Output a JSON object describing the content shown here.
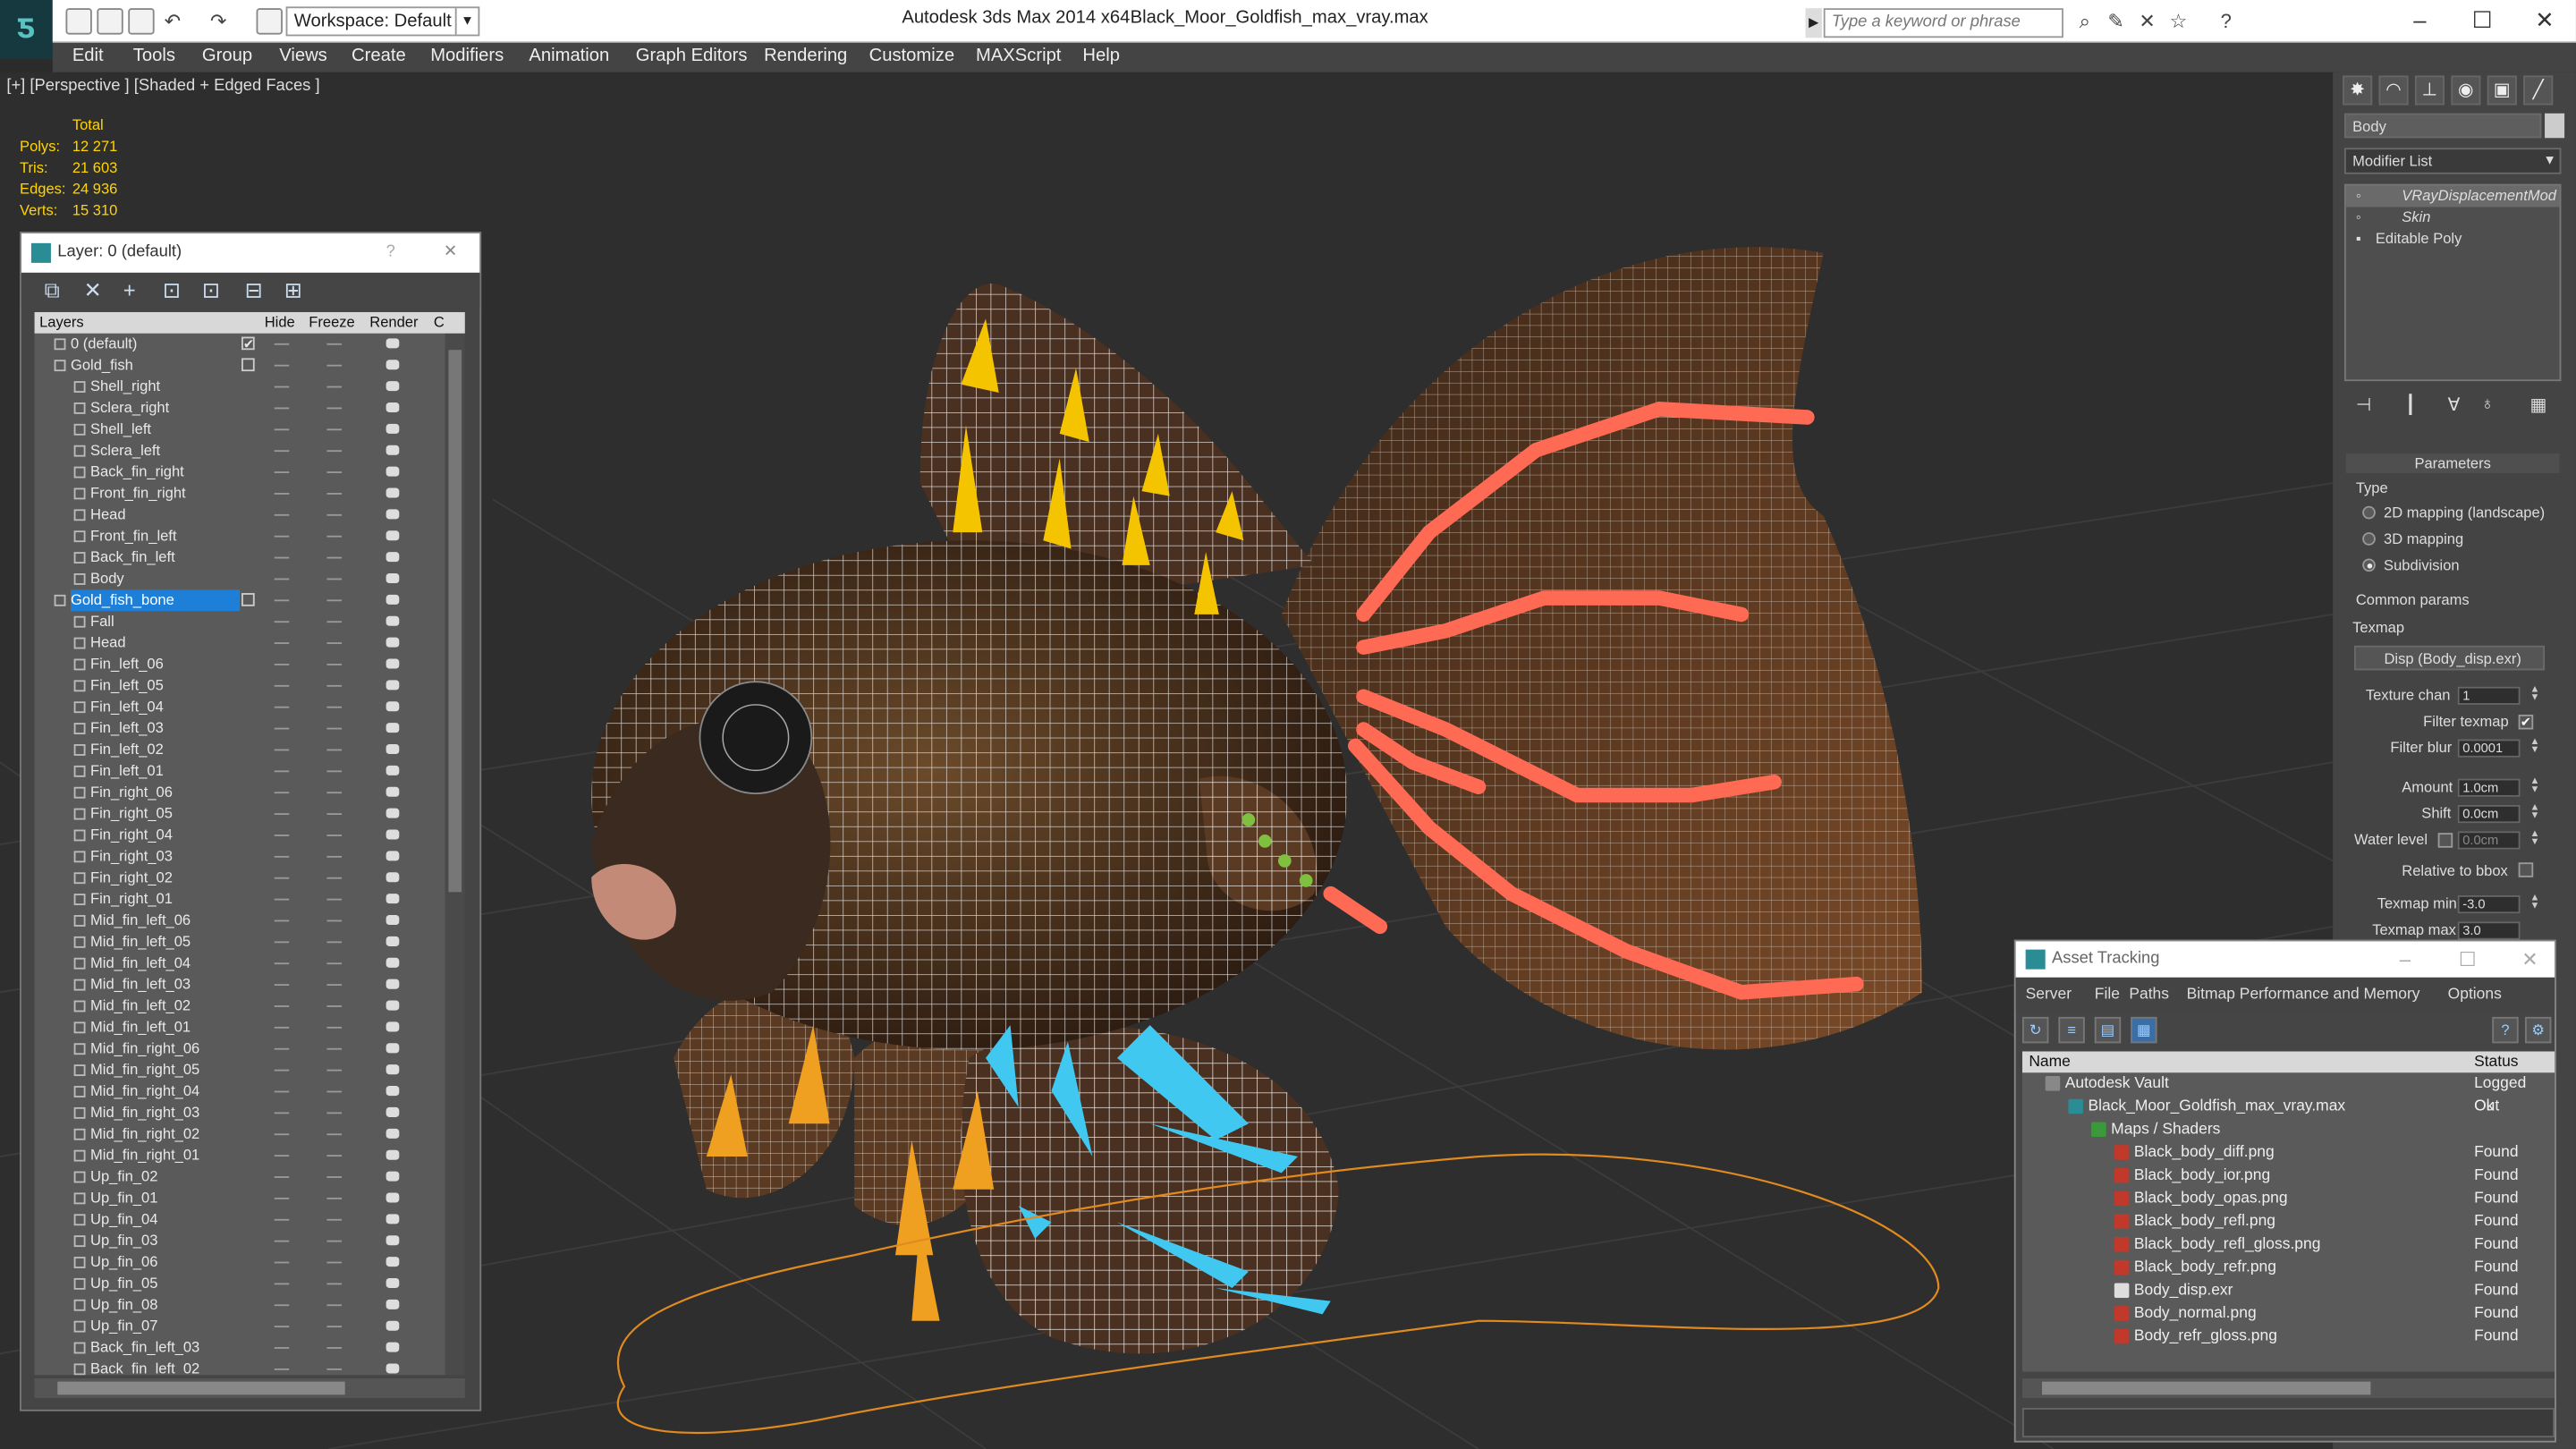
{
  "titlebar": {
    "workspace": "Workspace: Default",
    "app_title": "Autodesk 3ds Max 2014 x64",
    "file_title": "Black_Moor_Goldfish_max_vray.max",
    "search_placeholder": "Type a keyword or phrase"
  },
  "menu": [
    "Edit",
    "Tools",
    "Group",
    "Views",
    "Create",
    "Modifiers",
    "Animation",
    "Graph Editors",
    "Rendering",
    "Customize",
    "MAXScript",
    "Help"
  ],
  "viewport": {
    "label": "[+] [Perspective ] [Shaded + Edged Faces ]",
    "stats": {
      "header": "Total",
      "rows": [
        {
          "k": "Polys:",
          "v": "12 271"
        },
        {
          "k": "Tris:",
          "v": "21 603"
        },
        {
          "k": "Edges:",
          "v": "24 936"
        },
        {
          "k": "Verts:",
          "v": "15 310"
        }
      ]
    }
  },
  "layer_window": {
    "title": "Layer: 0 (default)",
    "help": "?",
    "close": "✕",
    "columns": [
      "Layers",
      "Hide",
      "Freeze",
      "Render",
      "C"
    ],
    "rows": [
      {
        "name": "0 (default)",
        "indent": 0,
        "check": "✔"
      },
      {
        "name": "Gold_fish",
        "indent": 0
      },
      {
        "name": "Shell_right",
        "indent": 1
      },
      {
        "name": "Sclera_right",
        "indent": 1
      },
      {
        "name": "Shell_left",
        "indent": 1
      },
      {
        "name": "Sclera_left",
        "indent": 1
      },
      {
        "name": "Back_fin_right",
        "indent": 1
      },
      {
        "name": "Front_fin_right",
        "indent": 1
      },
      {
        "name": "Head",
        "indent": 1
      },
      {
        "name": "Front_fin_left",
        "indent": 1
      },
      {
        "name": "Back_fin_left",
        "indent": 1
      },
      {
        "name": "Body",
        "indent": 1
      },
      {
        "name": "Gold_fish_bone",
        "indent": 0,
        "selected": true
      },
      {
        "name": "Fall",
        "indent": 1
      },
      {
        "name": "Head",
        "indent": 1
      },
      {
        "name": "Fin_left_06",
        "indent": 1
      },
      {
        "name": "Fin_left_05",
        "indent": 1
      },
      {
        "name": "Fin_left_04",
        "indent": 1
      },
      {
        "name": "Fin_left_03",
        "indent": 1
      },
      {
        "name": "Fin_left_02",
        "indent": 1
      },
      {
        "name": "Fin_left_01",
        "indent": 1
      },
      {
        "name": "Fin_right_06",
        "indent": 1
      },
      {
        "name": "Fin_right_05",
        "indent": 1
      },
      {
        "name": "Fin_right_04",
        "indent": 1
      },
      {
        "name": "Fin_right_03",
        "indent": 1
      },
      {
        "name": "Fin_right_02",
        "indent": 1
      },
      {
        "name": "Fin_right_01",
        "indent": 1
      },
      {
        "name": "Mid_fin_left_06",
        "indent": 1
      },
      {
        "name": "Mid_fin_left_05",
        "indent": 1
      },
      {
        "name": "Mid_fin_left_04",
        "indent": 1
      },
      {
        "name": "Mid_fin_left_03",
        "indent": 1
      },
      {
        "name": "Mid_fin_left_02",
        "indent": 1
      },
      {
        "name": "Mid_fin_left_01",
        "indent": 1
      },
      {
        "name": "Mid_fin_right_06",
        "indent": 1
      },
      {
        "name": "Mid_fin_right_05",
        "indent": 1
      },
      {
        "name": "Mid_fin_right_04",
        "indent": 1
      },
      {
        "name": "Mid_fin_right_03",
        "indent": 1
      },
      {
        "name": "Mid_fin_right_02",
        "indent": 1
      },
      {
        "name": "Mid_fin_right_01",
        "indent": 1
      },
      {
        "name": "Up_fin_02",
        "indent": 1
      },
      {
        "name": "Up_fin_01",
        "indent": 1
      },
      {
        "name": "Up_fin_04",
        "indent": 1
      },
      {
        "name": "Up_fin_03",
        "indent": 1
      },
      {
        "name": "Up_fin_06",
        "indent": 1
      },
      {
        "name": "Up_fin_05",
        "indent": 1
      },
      {
        "name": "Up_fin_08",
        "indent": 1
      },
      {
        "name": "Up_fin_07",
        "indent": 1
      },
      {
        "name": "Back_fin_left_03",
        "indent": 1
      },
      {
        "name": "Back_fin_left_02",
        "indent": 1
      }
    ]
  },
  "command_panel": {
    "object_name": "Body",
    "modifier_list": "Modifier List",
    "stack": [
      "VRayDisplacementMod",
      "Skin",
      "Editable Poly"
    ],
    "params_title": "Parameters",
    "type_label": "Type",
    "type_options": [
      "2D mapping (landscape)",
      "3D mapping",
      "Subdivision"
    ],
    "common_label": "Common params",
    "texmap_label": "Texmap",
    "texmap_value": "Disp (Body_disp.exr)",
    "fields": [
      {
        "label": "Texture chan",
        "value": "1"
      },
      {
        "label": "Filter texmap",
        "check": "✔"
      },
      {
        "label": "Filter blur",
        "value": "0.0001"
      },
      {
        "label": "Amount",
        "value": "1.0cm"
      },
      {
        "label": "Shift",
        "value": "0.0cm"
      },
      {
        "label": "Water level",
        "value": "0.0cm"
      },
      {
        "label": "Relative to bbox"
      },
      {
        "label": "Texmap min",
        "value": "-3.0"
      },
      {
        "label": "Texmap max",
        "value": "3.0"
      }
    ]
  },
  "asset_tracking": {
    "title": "Asset Tracking",
    "menu": [
      "Server",
      "File",
      "Paths",
      "Bitmap Performance and Memory",
      "Options"
    ],
    "columns": [
      "Name",
      "Status"
    ],
    "rows": [
      {
        "name": "Autodesk Vault",
        "status": "Logged Out",
        "indent": 0,
        "icon": "vault"
      },
      {
        "name": "Black_Moor_Goldfish_max_vray.max",
        "status": "Ok",
        "indent": 1,
        "icon": "max"
      },
      {
        "name": "Maps / Shaders",
        "status": "",
        "indent": 2,
        "icon": "folder"
      },
      {
        "name": "Black_body_diff.png",
        "status": "Found",
        "indent": 3,
        "icon": "png"
      },
      {
        "name": "Black_body_ior.png",
        "status": "Found",
        "indent": 3,
        "icon": "png"
      },
      {
        "name": "Black_body_opas.png",
        "status": "Found",
        "indent": 3,
        "icon": "png"
      },
      {
        "name": "Black_body_refl.png",
        "status": "Found",
        "indent": 3,
        "icon": "png"
      },
      {
        "name": "Black_body_refl_gloss.png",
        "status": "Found",
        "indent": 3,
        "icon": "png"
      },
      {
        "name": "Black_body_refr.png",
        "status": "Found",
        "indent": 3,
        "icon": "png"
      },
      {
        "name": "Body_disp.exr",
        "status": "Found",
        "indent": 3,
        "icon": "exr"
      },
      {
        "name": "Body_normal.png",
        "status": "Found",
        "indent": 3,
        "icon": "png"
      },
      {
        "name": "Body_refr_gloss.png",
        "status": "Found",
        "indent": 3,
        "icon": "png"
      }
    ]
  }
}
